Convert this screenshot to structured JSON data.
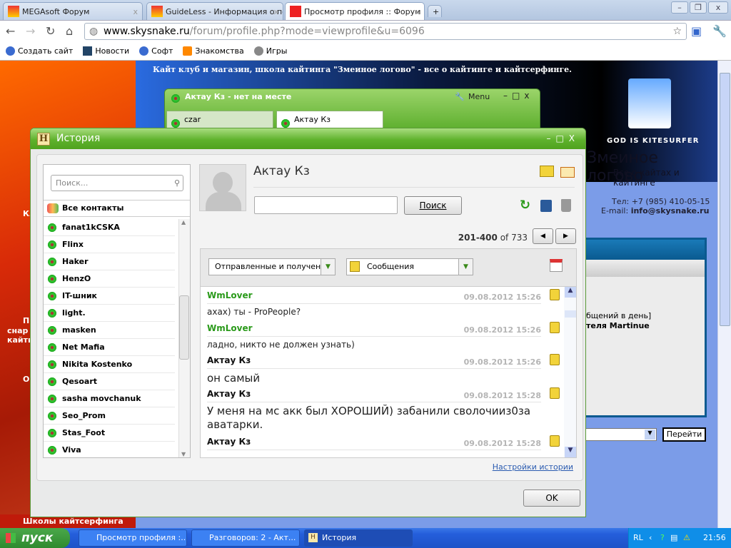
{
  "browser": {
    "tabs": [
      {
        "label": "MEGAsoft Форум"
      },
      {
        "label": "GuideLess - Информация о по"
      },
      {
        "label": "Просмотр профиля :: Форум"
      }
    ],
    "url_host": "www.skysnake.ru",
    "url_path": "/forum/profile.php?mode=viewprofile&u=6096",
    "bookmarks": [
      "Создать сайт",
      "Новости",
      "Софт",
      "Знакомства",
      "Игры"
    ]
  },
  "page": {
    "banner_text": "Кайт клуб и магазин, школа кайтинга \"Змеиное логово\" - все о кайтинге и кайтсерфинге.",
    "logo_caption": "GOD IS KITESURFER",
    "site_title": "Змеиное логово",
    "site_subtitle": "Все о кайтах и кайтинге",
    "phone": "Тел: +7 (985) 410-05-15",
    "email_label": "E-mail:",
    "email": "info@skysnake.ru",
    "frag1": "бщений в день]",
    "frag2": "теля Martinue",
    "go_button": "Перейти",
    "left_footer": "Школы кайтсерфинга",
    "left_frags": [
      "Кл",
      "Пр",
      "снар",
      "кайти",
      "О"
    ]
  },
  "icq_window": {
    "title": "Актау Кз - нет на месте",
    "menu": "Menu",
    "tabs": [
      "czar",
      "Актау Кз"
    ]
  },
  "history": {
    "title": "История",
    "search_placeholder": "Поиск...",
    "all_contacts": "Все контакты",
    "contacts": [
      "fanat1kCSKA",
      "Flinx",
      "Haker",
      "HenzO",
      "IT-шник",
      "light.",
      "masken",
      "Net Mafia",
      "Nikita Kostenko",
      "Qesoart",
      "sasha movchanuk",
      "Seo_Prom",
      "Stas_Foot",
      "Viva"
    ],
    "contact_name": "Актау Кз",
    "search_button": "Поиск",
    "paging_range": "201-400",
    "paging_of": "of 733",
    "filter_direction": "Отправленные и получен...",
    "filter_type": "Сообщения",
    "messages": [
      {
        "author": "WmLover",
        "time": "09.08.2012 15:26",
        "text": "ахах) ты - ProPeople?",
        "color": "#2a9a1a"
      },
      {
        "author": "WmLover",
        "time": "09.08.2012 15:26",
        "text": "ладно, никто не должен узнать)",
        "color": "#2a9a1a"
      },
      {
        "author": "Актау Кз",
        "time": "09.08.2012 15:26",
        "text": "он самый",
        "color": "#111111"
      },
      {
        "author": "Актау Кз",
        "time": "09.08.2012 15:28",
        "text": "У меня на мс акк был ХОРОШИЙ) забанили сволочииз0за аватарки.",
        "color": "#111111"
      },
      {
        "author": "Актау Кз",
        "time": "09.08.2012 15:28",
        "text": "",
        "color": "#111111"
      }
    ],
    "settings_link": "Настройки истории",
    "ok_button": "OK"
  },
  "taskbar": {
    "start": "пуск",
    "tasks": [
      "Просмотр профиля :...",
      "Разговоров: 2 - Акт...",
      "История"
    ],
    "lang": "RL",
    "clock": "21:56"
  }
}
